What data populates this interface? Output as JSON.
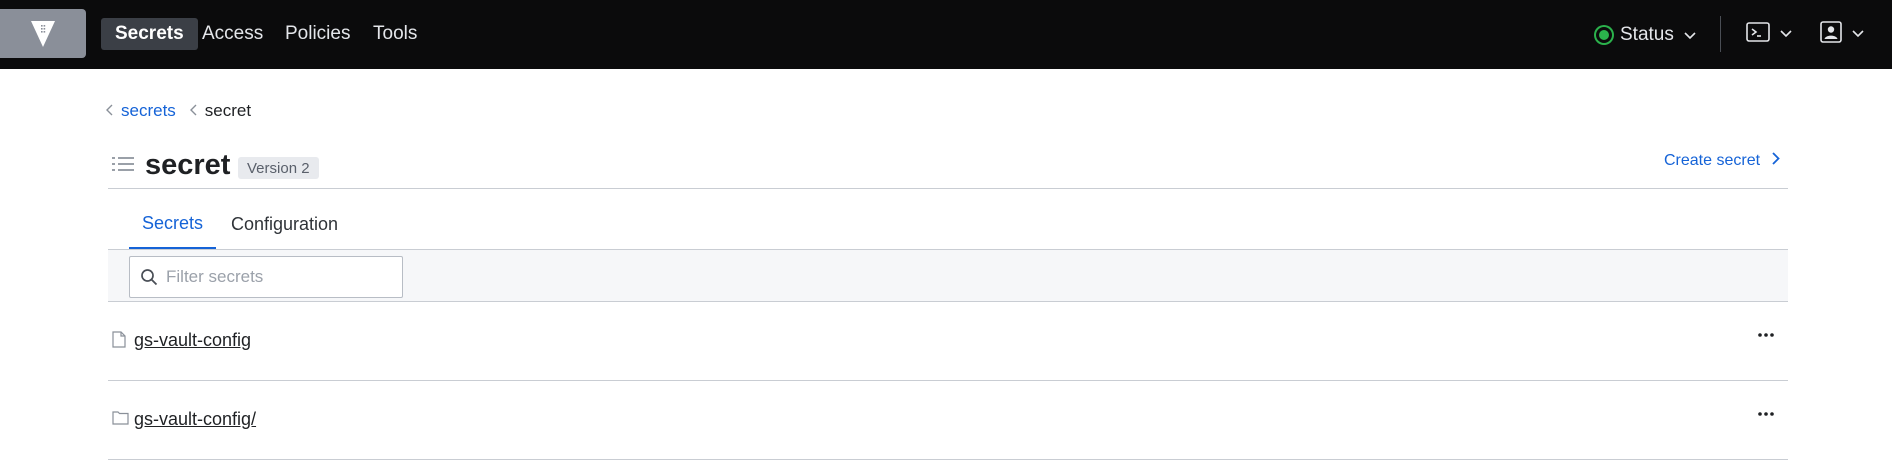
{
  "nav": {
    "logo_icon": "vault-logo-icon",
    "items": [
      {
        "label": "Secrets",
        "active": true
      },
      {
        "label": "Access",
        "active": false
      },
      {
        "label": "Policies",
        "active": false
      },
      {
        "label": "Tools",
        "active": false
      }
    ],
    "status_label": "Status",
    "status_color": "#2bb24c",
    "console_icon": "terminal-icon",
    "user_icon": "user-icon"
  },
  "breadcrumb": [
    {
      "label": "secrets",
      "link": true
    },
    {
      "label": "secret",
      "link": false
    }
  ],
  "header": {
    "title": "secret",
    "version_badge": "Version 2",
    "create_label": "Create secret"
  },
  "tabs": [
    {
      "label": "Secrets",
      "active": true
    },
    {
      "label": "Configuration",
      "active": false
    }
  ],
  "filter": {
    "placeholder": "Filter secrets",
    "value": ""
  },
  "rows": [
    {
      "label": "gs-vault-config",
      "type": "file",
      "icon": "file-icon"
    },
    {
      "label": "gs-vault-config/",
      "type": "folder",
      "icon": "folder-icon"
    }
  ],
  "colors": {
    "accent": "#1563d7",
    "nav_bg": "#0b0b0c"
  }
}
